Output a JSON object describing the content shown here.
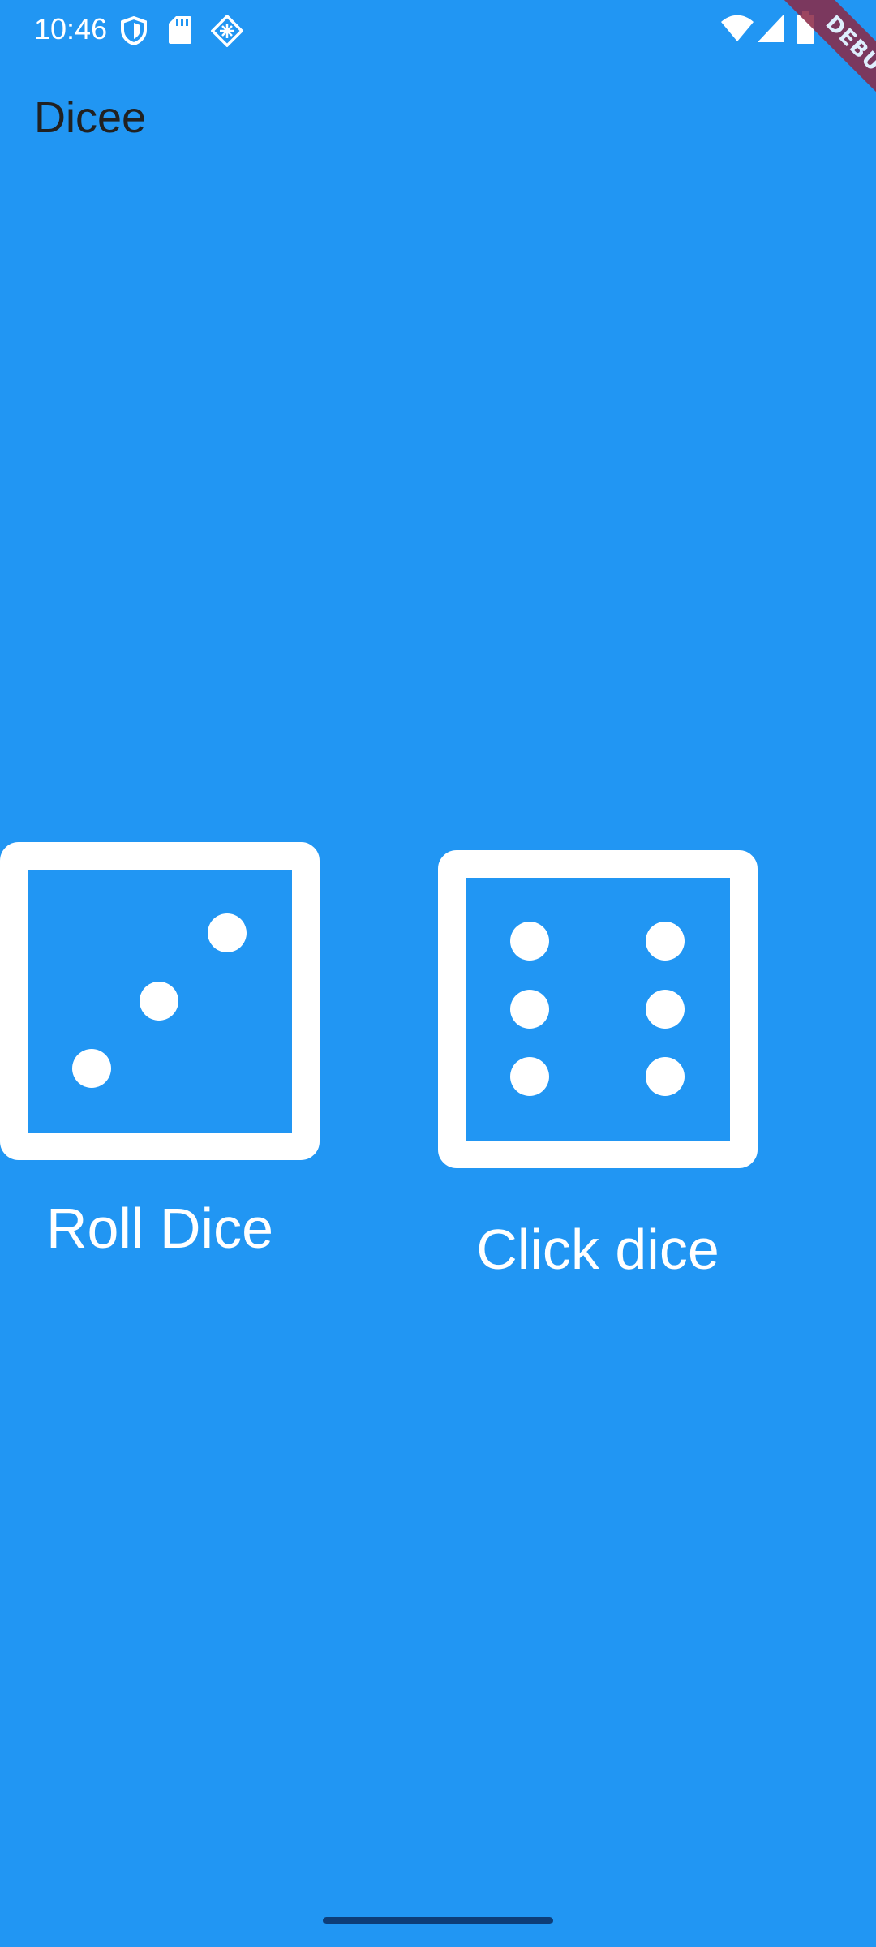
{
  "status_bar": {
    "time": "10:46",
    "left_icons": [
      "shield-icon",
      "sd-card-icon",
      "network-diamond-icon"
    ],
    "right_icons": [
      "wifi-icon",
      "cell-signal-icon",
      "battery-icon"
    ]
  },
  "app_bar": {
    "title": "Dicee"
  },
  "dice": [
    {
      "face": 3,
      "label": "Roll Dice",
      "icon": "dice-three-icon"
    },
    {
      "face": 6,
      "label": "Click dice",
      "icon": "dice-six-icon"
    }
  ],
  "debug_banner": {
    "label": "DEBUG"
  },
  "colors": {
    "background": "#2196f3",
    "foreground": "#ffffff",
    "title_text": "#212121",
    "debug_banner": "#8b2845"
  }
}
